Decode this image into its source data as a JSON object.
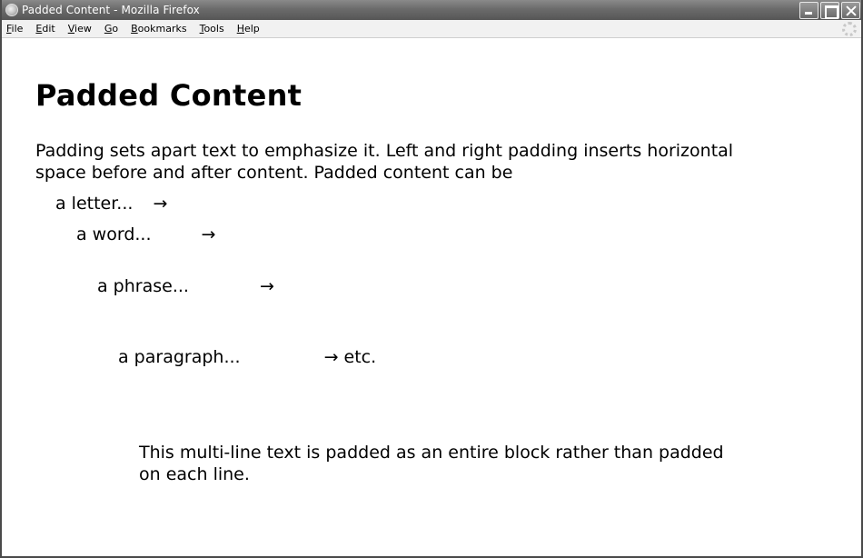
{
  "window": {
    "title": "Padded Content - Mozilla Firefox"
  },
  "menu": [
    {
      "label": "File",
      "accel": "F",
      "rest": "ile"
    },
    {
      "label": "Edit",
      "accel": "E",
      "rest": "dit"
    },
    {
      "label": "View",
      "accel": "V",
      "rest": "iew"
    },
    {
      "label": "Go",
      "accel": "G",
      "rest": "o"
    },
    {
      "label": "Bookmarks",
      "accel": "B",
      "rest": "ookmarks"
    },
    {
      "label": "Tools",
      "accel": "T",
      "rest": "ools"
    },
    {
      "label": "Help",
      "accel": "H",
      "rest": "elp"
    }
  ],
  "page": {
    "heading": "Padded Content",
    "intro": "Padding sets apart text to emphasize it. Left and right padding inserts horizontal space before and after content. Padded content can be",
    "examples": [
      {
        "text": "a letter...",
        "arrow": "→",
        "suffix": ""
      },
      {
        "text": "a word...",
        "arrow": "→",
        "suffix": ""
      },
      {
        "text": "a phrase...",
        "arrow": "→",
        "suffix": ""
      },
      {
        "text": "a paragraph...",
        "arrow": "→",
        "suffix": " etc."
      }
    ],
    "block_text": "This multi-line text is padded as an entire block rather than padded on each line."
  }
}
